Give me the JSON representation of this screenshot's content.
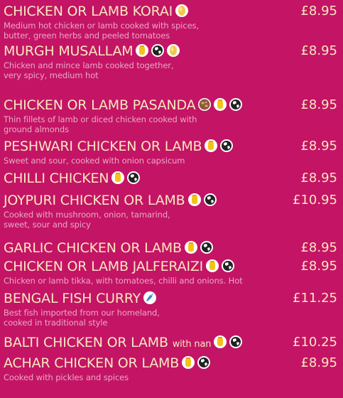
{
  "menu": {
    "items": [
      {
        "name": "CHICKEN OR LAMB KORAI",
        "suffix": "",
        "price": "£8.95",
        "icons": [
          "mild-icon"
        ],
        "desc": "Medium hot chicken or lamb cooked with spices,\nbutter, green herbs and peeled tomatoes"
      },
      {
        "name": "MURGH MUSALLAM",
        "suffix": "",
        "price": "£8.95",
        "icons": [
          "medium-hot-icon",
          "globe-icon",
          "mild-icon"
        ],
        "desc": "Chicken and mince lamb cooked together,\nvery spicy, medium hot"
      },
      {
        "name": "CHICKEN OR LAMB PASANDA",
        "suffix": "",
        "price": "£8.95",
        "icons": [
          "nuts-icon",
          "medium-hot-icon",
          "globe-icon"
        ],
        "desc": "Thin fillets of lamb or diced chicken cooked with\nground almonds"
      },
      {
        "name": "PESHWARI CHICKEN OR LAMB",
        "suffix": "",
        "price": "£8.95",
        "icons": [
          "medium-hot-icon",
          "globe-icon"
        ],
        "desc": "Sweet and sour, cooked with onion capsicum"
      },
      {
        "name": "CHILLI CHICKEN",
        "suffix": "",
        "price": "£8.95",
        "icons": [
          "medium-hot-icon",
          "globe-icon"
        ],
        "desc": ""
      },
      {
        "name": "JOYPURI CHICKEN OR LAMB",
        "suffix": "",
        "price": "£10.95",
        "icons": [
          "medium-hot-icon",
          "globe-icon"
        ],
        "desc": "Cooked with mushroom, onion, tamarind,\nsweet, sour and spicy"
      },
      {
        "name": "GARLIC CHICKEN OR LAMB",
        "suffix": "",
        "price": "£8.95",
        "icons": [
          "medium-hot-icon",
          "globe-icon"
        ],
        "desc": ""
      },
      {
        "name": "CHICKEN OR LAMB JALFERAIZI",
        "suffix": "",
        "price": "£8.95",
        "icons": [
          "medium-hot-icon",
          "globe-icon"
        ],
        "desc": "Chicken or lamb tikka, with tomatoes, chilli and onions. Hot"
      },
      {
        "name": "BENGAL FISH CURRY",
        "suffix": "",
        "price": "£11.25",
        "icons": [
          "fish-icon"
        ],
        "desc": "Best fish imported from our homeland,\ncooked in traditional style"
      },
      {
        "name": "BALTI CHICKEN OR LAMB",
        "suffix": "with nan",
        "price": "£10.25",
        "icons": [
          "medium-hot-icon",
          "globe-icon"
        ],
        "desc": ""
      },
      {
        "name": "ACHAR CHICKEN OR LAMB",
        "suffix": "",
        "price": "£8.95",
        "icons": [
          "medium-hot-icon",
          "globe-icon"
        ],
        "desc": "Cooked with pickles and spices"
      }
    ]
  },
  "colors": {
    "background": "#c41466",
    "title": "#f7e9bd",
    "description": "#e9a9c5",
    "icon_mild": "#f0c84a",
    "icon_medium": "#f4c21b",
    "icon_nuts": "#8a5a38",
    "icon_fish": "#2f8fd0"
  }
}
